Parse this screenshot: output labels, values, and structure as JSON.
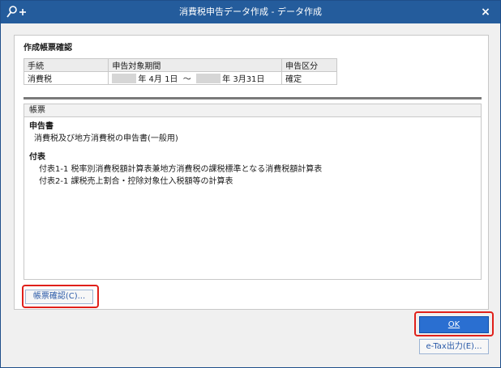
{
  "window": {
    "title": "消費税申告データ作成 - データ作成",
    "close_label": "×"
  },
  "confirm": {
    "section_title": "作成帳票確認",
    "headers": [
      "手続",
      "申告対象期間",
      "申告区分"
    ],
    "row": {
      "procedure": "消費税",
      "period_start": "年  4月  1日",
      "period_tilde": "～",
      "period_end": "年  3月31日",
      "category": "確定"
    }
  },
  "forms": {
    "header": "帳票",
    "group1_title": "申告書",
    "group1_items": [
      "消費税及び地方消費税の申告書(一般用)"
    ],
    "group2_title": "付表",
    "group2_items": [
      "付表1-1   税率別消費税額計算表兼地方消費税の課税標準となる消費税額計算表",
      "付表2-1   課税売上割合・控除対象仕入税額等の計算表"
    ]
  },
  "buttons": {
    "preview_label": "帳票確認(C)...",
    "ok_label": "OK",
    "etax_label": "e-Tax出力(E)..."
  },
  "colors": {
    "titlebar": "#245c9c",
    "ok_button": "#2a6fd1",
    "highlight": "#e0201a"
  },
  "icons": {
    "title_icon": "key-search-plus-icon",
    "close": "close-icon"
  }
}
